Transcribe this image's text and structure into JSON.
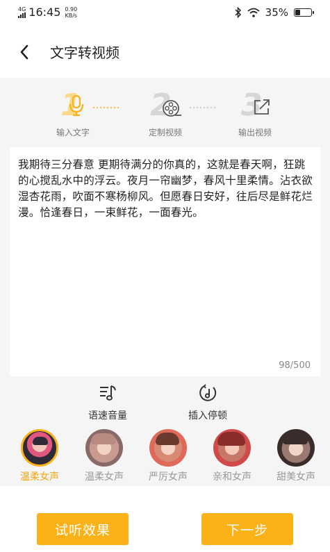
{
  "status": {
    "network": "4G",
    "time": "16:45",
    "speed_value": "0.90",
    "speed_unit": "KB/s",
    "battery": "35%",
    "battery_level": 0.35
  },
  "header": {
    "title": "文字转视频"
  },
  "steps": [
    {
      "num": "1",
      "label": "输入文字",
      "active": true
    },
    {
      "num": "2",
      "label": "定制视频",
      "active": false
    },
    {
      "num": "3",
      "label": "输出视频",
      "active": false
    }
  ],
  "editor": {
    "text": "我期待三分春意 更期待满分的你真的，这就是春天啊，狂跳的心搅乱水中的浮云。夜月一帘幽梦，春风十里柔情。沾衣欲湿杏花雨，吹面不寒杨柳风。但愿春日安好，往后尽是鲜花烂漫。恰逢春日，一束鲜花，一面春光。",
    "count": "98/500"
  },
  "tools": {
    "speed_volume": "语速音量",
    "insert_pause": "插入停顿"
  },
  "voices": [
    {
      "label": "温柔女声",
      "selected": true
    },
    {
      "label": "温柔女声",
      "selected": false
    },
    {
      "label": "严厉女声",
      "selected": false
    },
    {
      "label": "亲和女声",
      "selected": false
    },
    {
      "label": "甜美女声",
      "selected": false
    }
  ],
  "footer": {
    "preview": "试听效果",
    "next": "下一步"
  },
  "colors": {
    "accent": "#fbb219",
    "selected_text": "#f9a410",
    "inactive_step": "#d6d6d6"
  }
}
